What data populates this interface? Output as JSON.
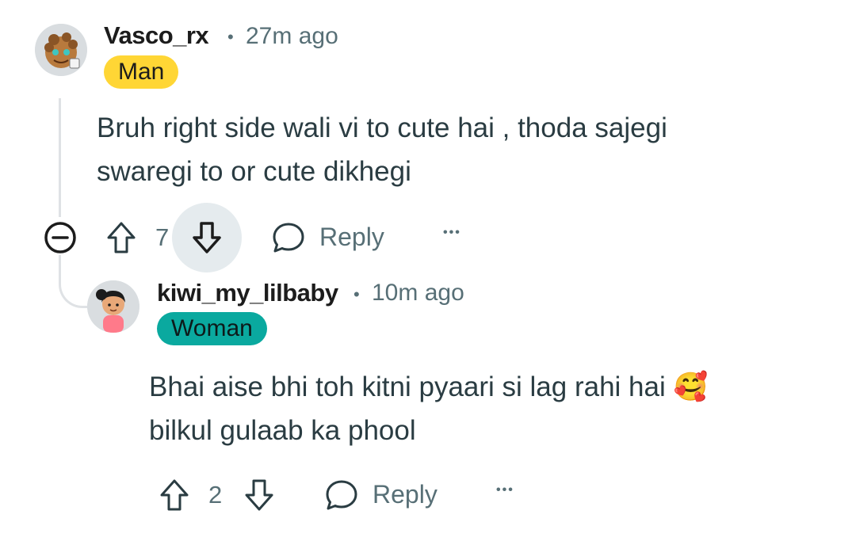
{
  "comments": [
    {
      "username": "Vasco_rx",
      "separator": "•",
      "time": "27m ago",
      "flair": "Man",
      "flair_color": "#ffd635",
      "body_line1": "Bruh right side wali vi to cute hai , thoda sajegi",
      "body_line2": "swaregi to or cute dikhegi",
      "votes": "7",
      "reply_label": "Reply",
      "more": "•••"
    },
    {
      "username": "kiwi_my_lilbaby",
      "separator": "•",
      "time": "10m ago",
      "flair": "Woman",
      "flair_color": "#0aa99f",
      "body_line1": "Bhai aise bhi toh kitni pyaari si lag rahi hai",
      "body_emoji": "🥰",
      "body_line2": "bilkul gulaab ka phool",
      "votes": "2",
      "reply_label": "Reply",
      "more": "•••"
    }
  ],
  "icons": {
    "collapse": "collapse-thread-icon",
    "upvote": "upvote-arrow-icon",
    "downvote": "downvote-arrow-icon",
    "reply": "speech-bubble-icon",
    "more": "ellipsis-icon"
  }
}
